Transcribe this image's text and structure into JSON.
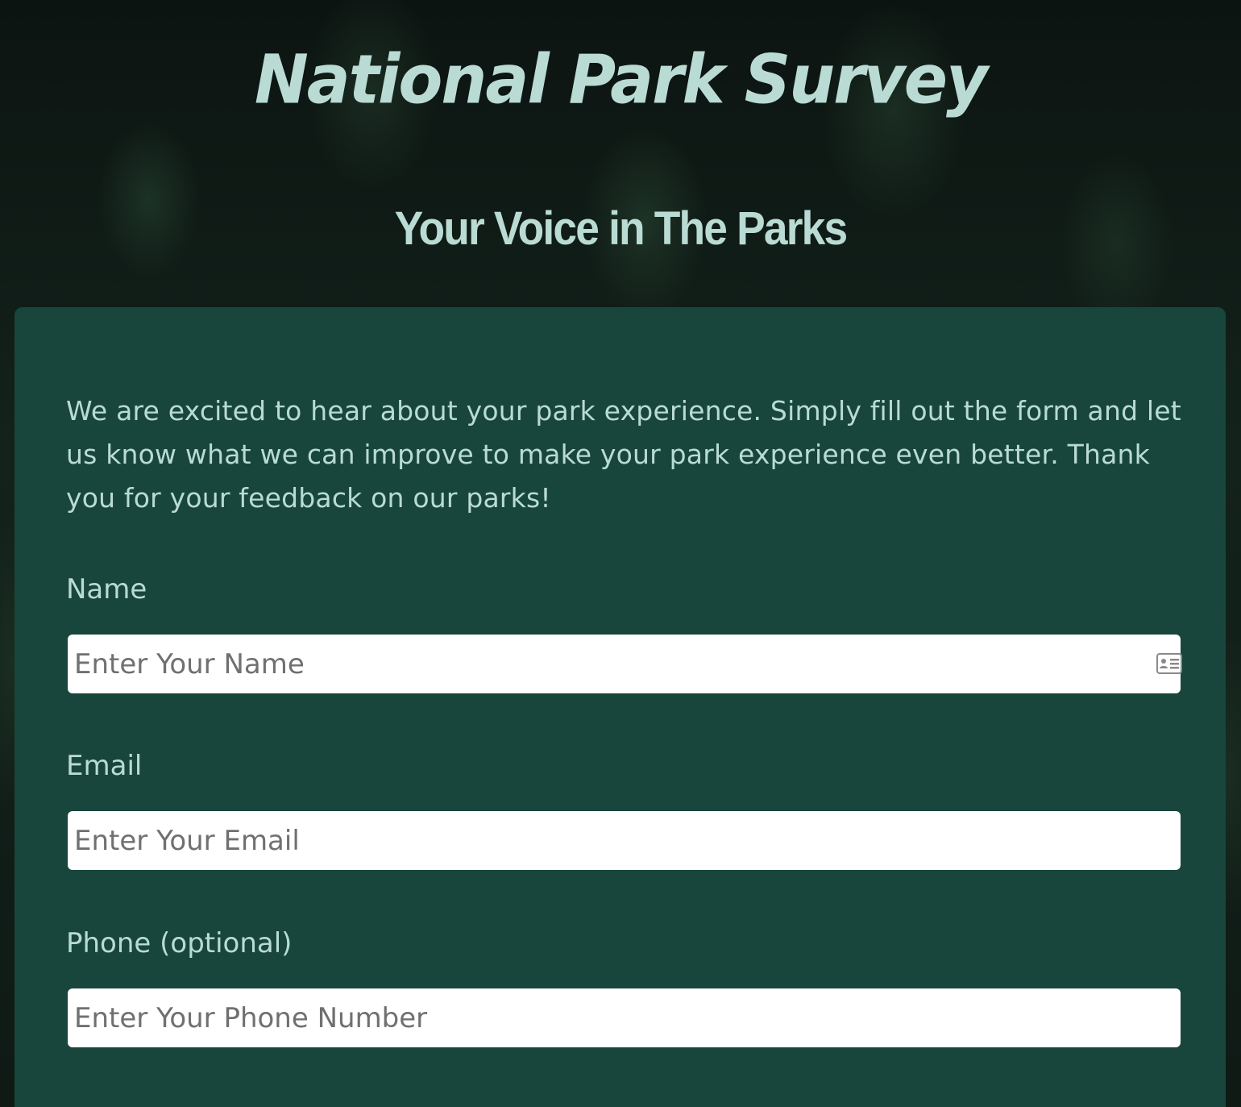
{
  "header": {
    "title": "National Park Survey",
    "subtitle": "Your Voice in The Parks"
  },
  "form": {
    "intro": "We are excited to hear about your park experience. Simply fill out the form and let us know what we can improve to make your park experience even better. Thank you for your feedback on our parks!",
    "fields": [
      {
        "label": "Name",
        "placeholder": "Enter Your Name",
        "value": "",
        "icon": "id-card-icon"
      },
      {
        "label": "Email",
        "placeholder": "Enter Your Email",
        "value": ""
      },
      {
        "label": "Phone (optional)",
        "placeholder": "Enter Your Phone Number",
        "value": ""
      }
    ]
  },
  "colors": {
    "text_accent": "#b9dbd4",
    "card_background": "#18463d",
    "input_background": "#ffffff",
    "placeholder": "#707070"
  }
}
